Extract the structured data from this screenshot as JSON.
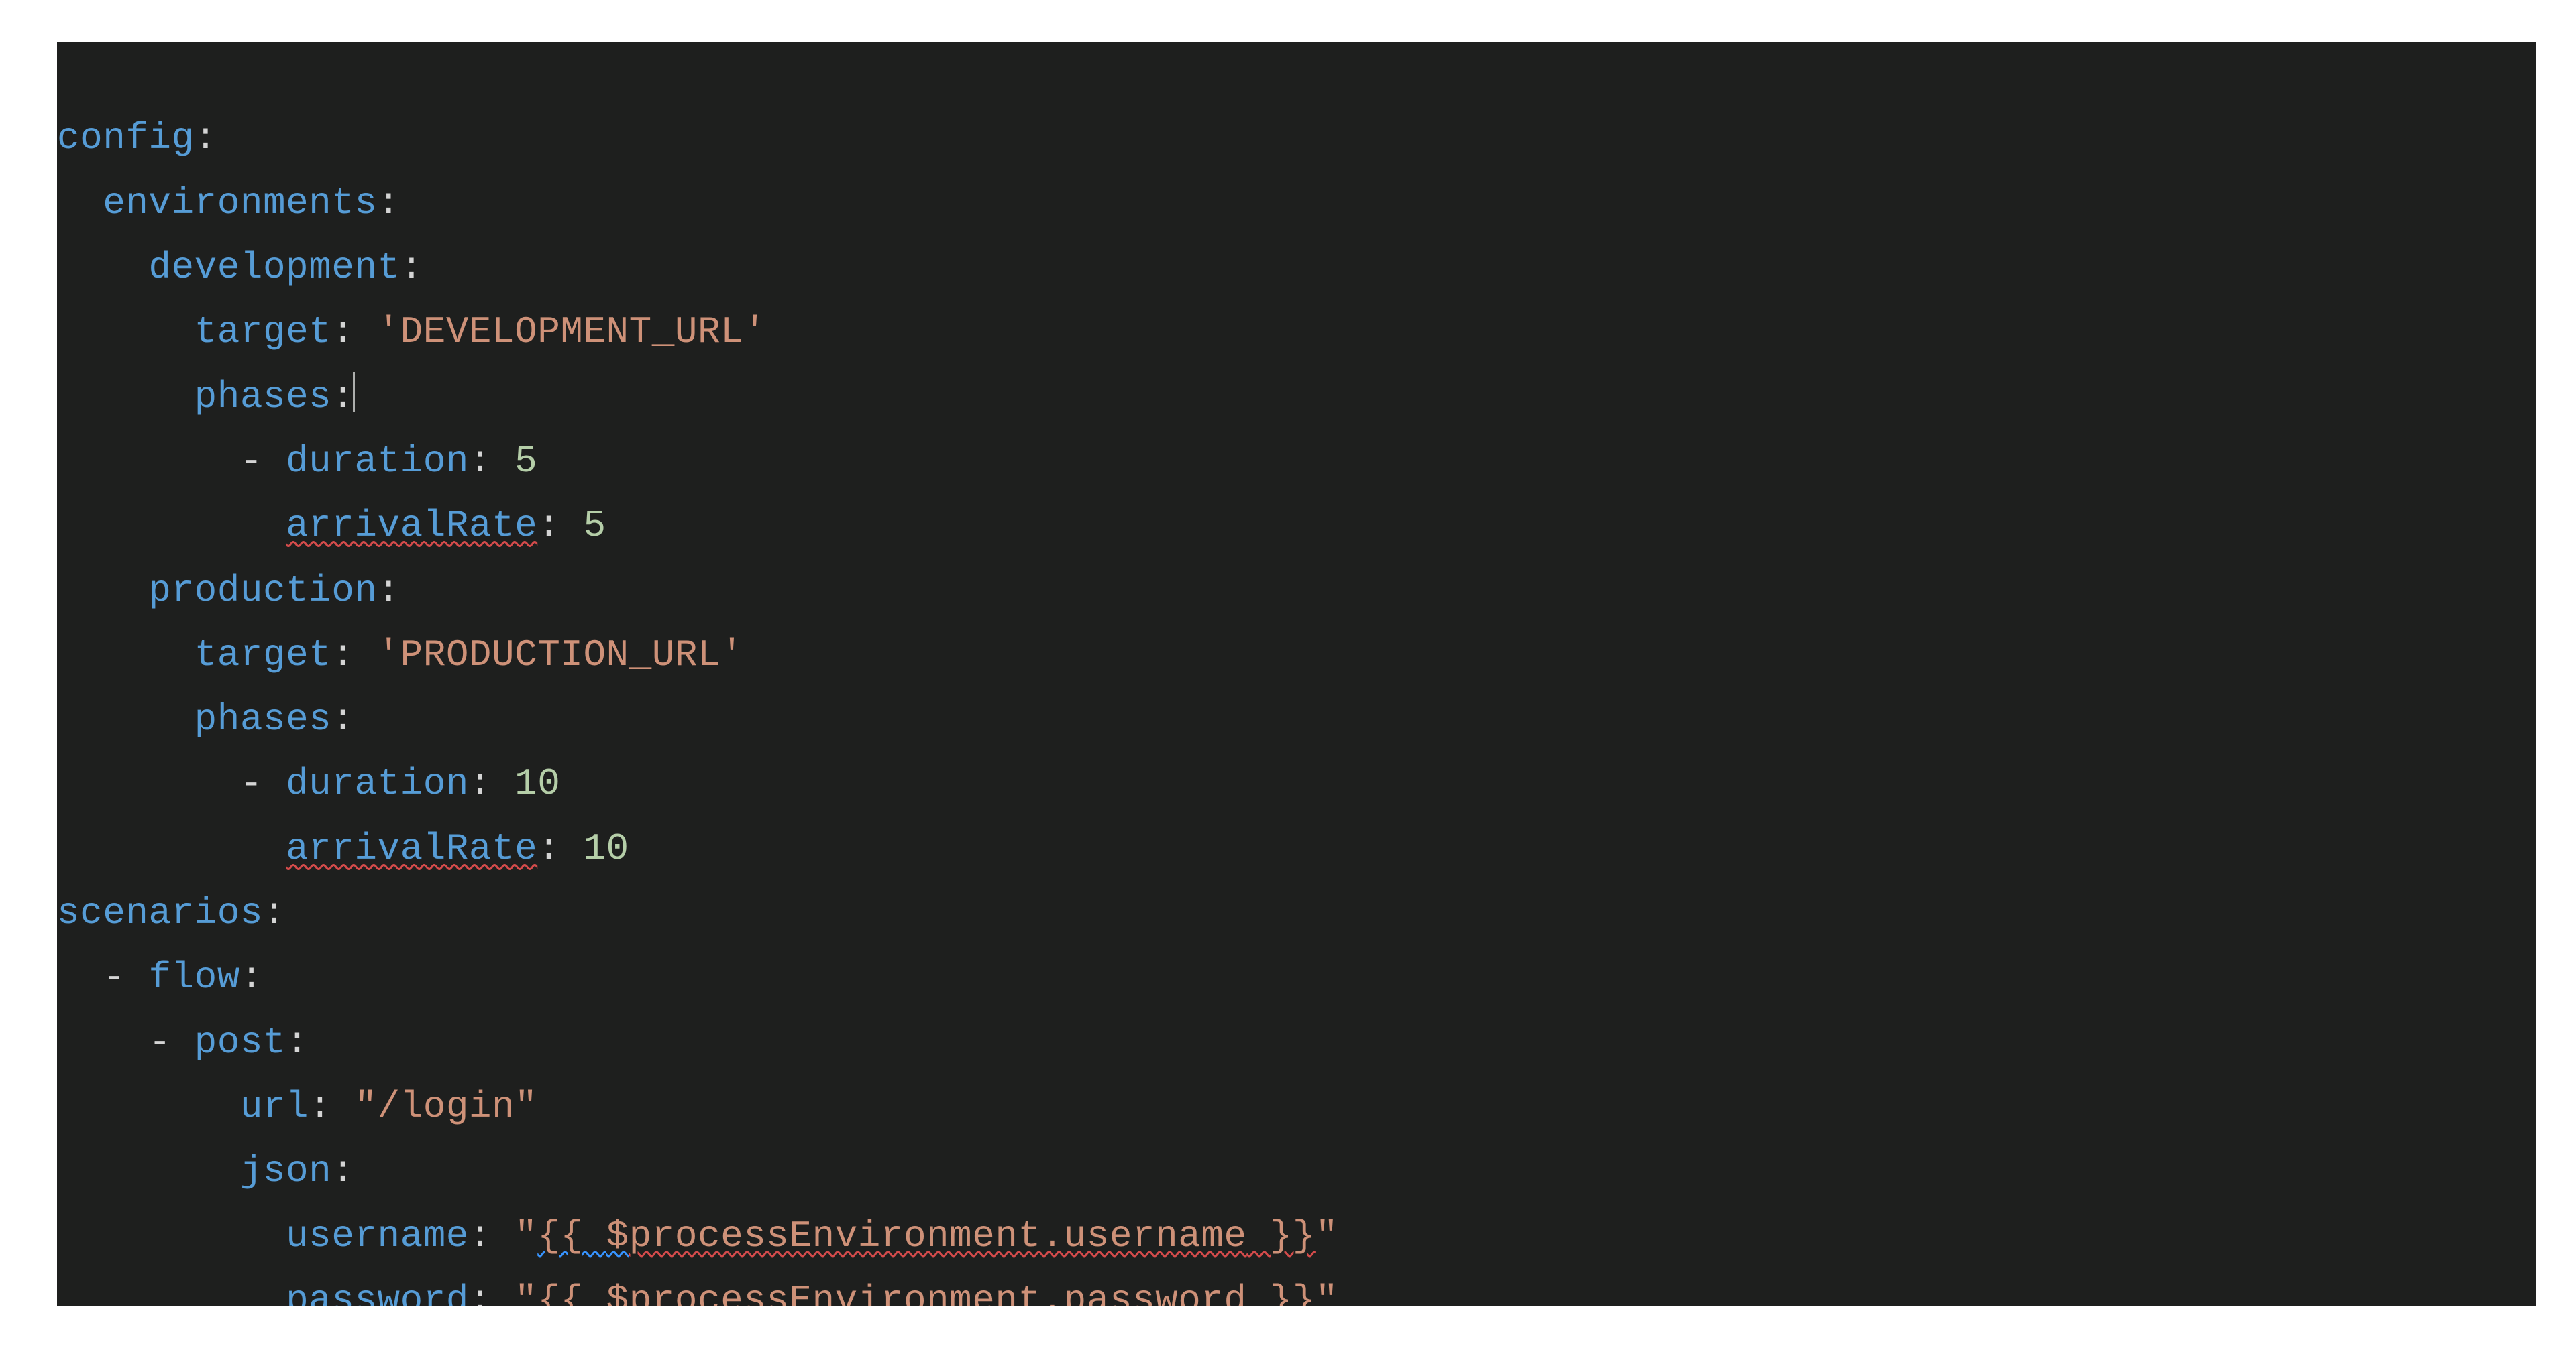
{
  "code": {
    "l1": {
      "k": "config"
    },
    "l2": {
      "k": "environments"
    },
    "l3": {
      "k": "development"
    },
    "l4": {
      "k": "target",
      "v": "'DEVELOPMENT_URL'"
    },
    "l5": {
      "k": "phases"
    },
    "l6": {
      "k": "duration",
      "v": "5"
    },
    "l7": {
      "k": "arrivalRate",
      "v": "5"
    },
    "l8": {
      "k": "production"
    },
    "l9": {
      "k": "target",
      "v": "'PRODUCTION_URL'"
    },
    "l10": {
      "k": "phases"
    },
    "l11": {
      "k": "duration",
      "v": "10"
    },
    "l12": {
      "k": "arrivalRate",
      "v": "10"
    },
    "l13": {
      "k": "scenarios"
    },
    "l14": {
      "k": "flow"
    },
    "l15": {
      "k": "post"
    },
    "l16": {
      "k": "url",
      "v": "\"/login\""
    },
    "l17": {
      "k": "json"
    },
    "l18": {
      "k": "username",
      "q1": "\"",
      "v_pre": "{{ ",
      "v_sig": "$",
      "v_mid": "processEnvironment.username",
      "v_post": " }}",
      "q2": "\""
    },
    "l19": {
      "k": "password",
      "q1": "\"",
      "v_pre": "{{ ",
      "v_sig": "$",
      "v_mid": "processEnvironment.password",
      "v_post": " }}",
      "q2": "\""
    }
  }
}
